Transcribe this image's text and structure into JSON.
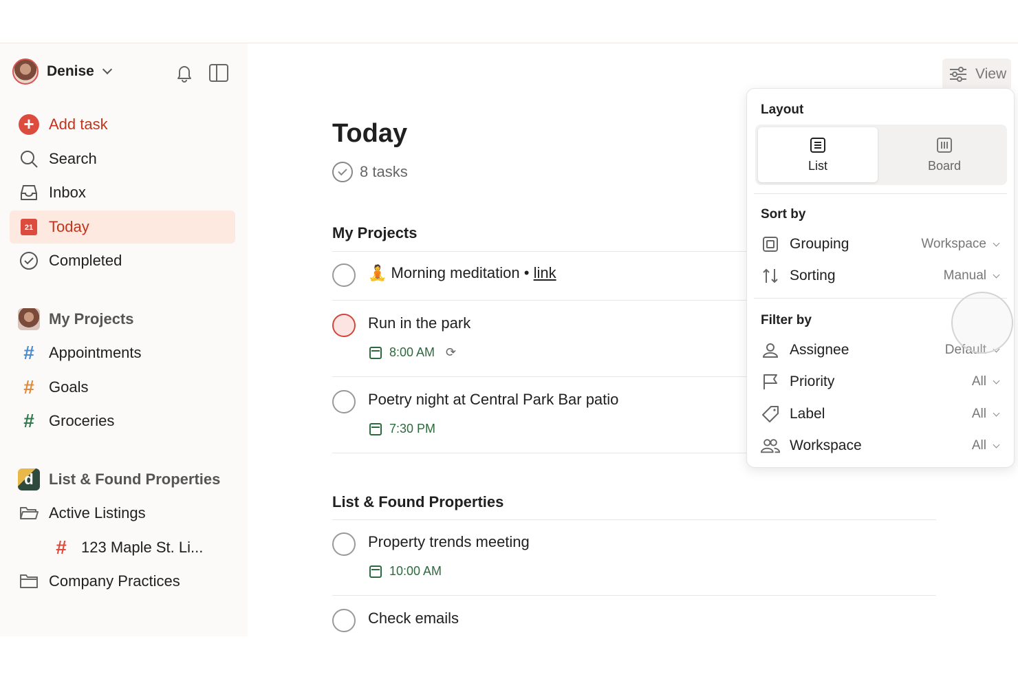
{
  "sidebar": {
    "user_name": "Denise",
    "add_task": "Add task",
    "nav": [
      {
        "label": "Search",
        "icon": "search-icon"
      },
      {
        "label": "Inbox",
        "icon": "inbox-icon"
      },
      {
        "label": "Today",
        "icon": "calendar-icon",
        "badge": "21"
      },
      {
        "label": "Completed",
        "icon": "check-circle-icon"
      }
    ],
    "my_projects_label": "My Projects",
    "projects": [
      {
        "label": "Appointments",
        "color": "#4a8bd1"
      },
      {
        "label": "Goals",
        "color": "#e08a3c"
      },
      {
        "label": "Groceries",
        "color": "#2f7a4a"
      }
    ],
    "workspace_label": "List & Found Properties",
    "workspace_logo": "d",
    "workspace_items": [
      {
        "label": "Active Listings"
      },
      {
        "label": "123 Maple St. Li...",
        "color": "#dc4c3e"
      },
      {
        "label": "Company Practices"
      }
    ]
  },
  "main": {
    "view_label": "View",
    "title": "Today",
    "task_count": "8 tasks",
    "groups": [
      {
        "title": "My Projects",
        "tasks": [
          {
            "emoji": "🧘",
            "name": "Morning meditation",
            "separator": "•",
            "link": "link"
          },
          {
            "name": "Run in the park",
            "time": "8:00 AM"
          },
          {
            "name": "Poetry night at Central Park Bar patio",
            "time": "7:30 PM"
          }
        ]
      },
      {
        "title": "List & Found Properties",
        "tasks": [
          {
            "name": "Property trends meeting",
            "time": "10:00 AM"
          },
          {
            "name": "Check emails"
          }
        ]
      }
    ]
  },
  "view_popover": {
    "layout_label": "Layout",
    "layout_options": [
      {
        "label": "List",
        "selected": true
      },
      {
        "label": "Board",
        "selected": false
      }
    ],
    "sort_label": "Sort by",
    "sort_options": [
      {
        "label": "Grouping",
        "value": "Workspace"
      },
      {
        "label": "Sorting",
        "value": "Manual"
      }
    ],
    "filter_label": "Filter by",
    "filter_options": [
      {
        "label": "Assignee",
        "value": "Default"
      },
      {
        "label": "Priority",
        "value": "All"
      },
      {
        "label": "Label",
        "value": "All"
      },
      {
        "label": "Workspace",
        "value": "All"
      }
    ]
  },
  "colors": {
    "accent": "#dc4c3e",
    "today_bg": "#fde9df",
    "time_green": "#2b6a3c"
  }
}
